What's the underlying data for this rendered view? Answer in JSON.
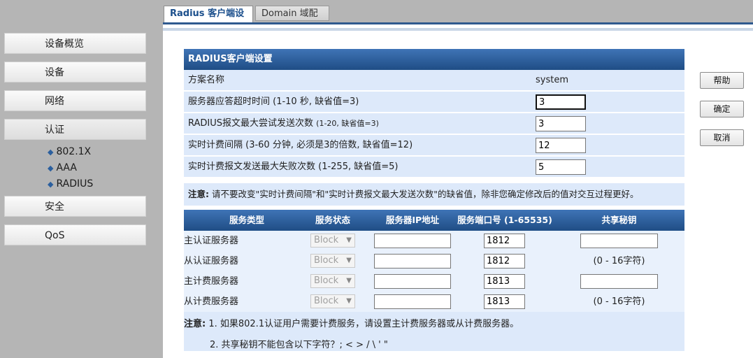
{
  "tabs": [
    {
      "label": "Radius 客户端设置"
    },
    {
      "label": "Domain 域配置"
    }
  ],
  "sidebar": {
    "items": [
      {
        "label": "设备概览"
      },
      {
        "label": "设备"
      },
      {
        "label": "网络"
      },
      {
        "label": "认证"
      },
      {
        "label": "安全"
      },
      {
        "label": "QoS"
      }
    ],
    "sub_items": [
      {
        "label": "802.1X"
      },
      {
        "label": "AAA"
      },
      {
        "label": "RADIUS"
      }
    ]
  },
  "radius": {
    "title": "RADIUS客户端设置",
    "scheme_label": "方案名称",
    "scheme_value": "system",
    "timeout_label": "服务器应答超时时间 (1-10 秒, 缺省值=3)",
    "timeout_value": "3",
    "retry_label": "RADIUS报文最大尝试发送次数",
    "retry_hint": "(1-20, 缺省值=3)",
    "retry_value": "3",
    "interval_label": "实时计费间隔 (3-60 分钟, 必须是3的倍数, 缺省值=12)",
    "interval_value": "12",
    "fail_label": "实时计费报文发送最大失败次数 (1-255, 缺省值=5)",
    "fail_value": "5"
  },
  "note1": {
    "bold": "注意:",
    "text": " 请不要改变\"实时计费间隔\"和\"实时计费报文最大发送次数\"的缺省值，除非您确定修改后的值对交互过程更好。"
  },
  "services": {
    "headers": [
      "服务类型",
      "服务状态",
      "服务器IP地址",
      "服务端口号 (1-65535)",
      "共享秘钥"
    ],
    "rows": [
      {
        "name": "主认证服务器",
        "status": "Block",
        "ip": "",
        "port": "1812",
        "secret": "",
        "secret_range": ""
      },
      {
        "name": "从认证服务器",
        "status": "Block",
        "ip": "",
        "port": "1812",
        "secret": null,
        "secret_range": "(0 - 16字符)"
      },
      {
        "name": "主计费服务器",
        "status": "Block",
        "ip": "",
        "port": "1813",
        "secret": "",
        "secret_range": ""
      },
      {
        "name": "从计费服务器",
        "status": "Block",
        "ip": "",
        "port": "1813",
        "secret": null,
        "secret_range": "(0 - 16字符)"
      }
    ]
  },
  "note2": {
    "bold": "注意:",
    "line1": " 1. 如果802.1认证用户需要计费服务，请设置主计费服务器或从计费服务器。",
    "line2": "2. 共享秘钥不能包含以下字符？; < > / \\ ' \""
  },
  "buttons": {
    "help": "帮助",
    "confirm": "确定",
    "cancel": "取消"
  }
}
